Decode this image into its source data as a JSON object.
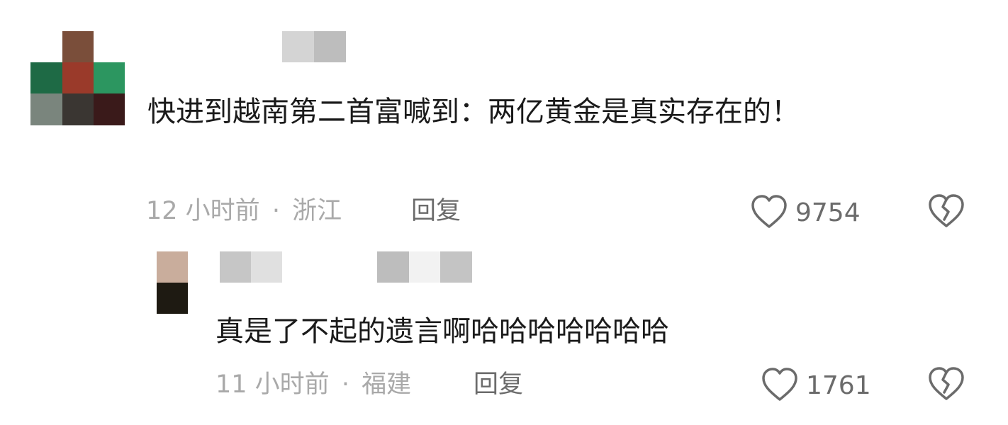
{
  "comments": [
    {
      "text": "快进到越南第二首富喊到：两亿黄金是真实存在的！",
      "time": "12 小时前",
      "separator": "·",
      "location": "浙江",
      "reply_label": "回复",
      "likes": "9754",
      "reply": {
        "text": "真是了不起的遗言啊哈哈哈哈哈哈哈",
        "time": "11 小时前",
        "separator": "·",
        "location": "福建",
        "reply_label": "回复",
        "likes": "1761"
      }
    }
  ],
  "icons": {
    "like": "heart-outline-icon",
    "dislike": "broken-heart-icon"
  },
  "colors": {
    "text": "#1a1a1a",
    "meta": "#a9a9a9",
    "action": "#6b6b6b"
  }
}
